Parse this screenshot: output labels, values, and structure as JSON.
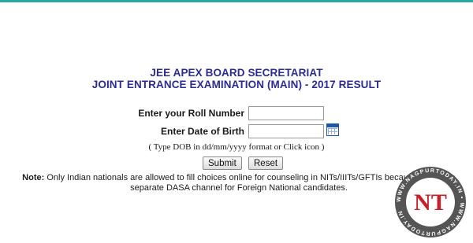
{
  "header": {
    "title_line1": "JEE APEX BOARD SECRETARIAT",
    "title_line2": "JOINT ENTRANCE EXAMINATION (MAIN) - 2017 RESULT"
  },
  "form": {
    "roll_number_label": "Enter your Roll Number",
    "roll_number_value": "",
    "dob_label": "Enter Date of Birth",
    "dob_value": "",
    "calendar_icon": "calendar-icon",
    "dob_hint": "( Type DOB in dd/mm/yyyy format or Click icon )",
    "submit_label": "Submit",
    "reset_label": "Reset"
  },
  "note": {
    "label": "Note:",
    "text": " Only Indian nationals are allowed to fill choices online for counseling in NITs/IIITs/GFTIs because there is a separate DASA channel for Foreign National candidates."
  },
  "watermark": {
    "logo_text": "NT",
    "ring_text": "WWW.NAGPURTODAY.IN",
    "colors": {
      "circle": "#555555",
      "letters": "#c8202a",
      "accent": "#2b2b96"
    }
  }
}
